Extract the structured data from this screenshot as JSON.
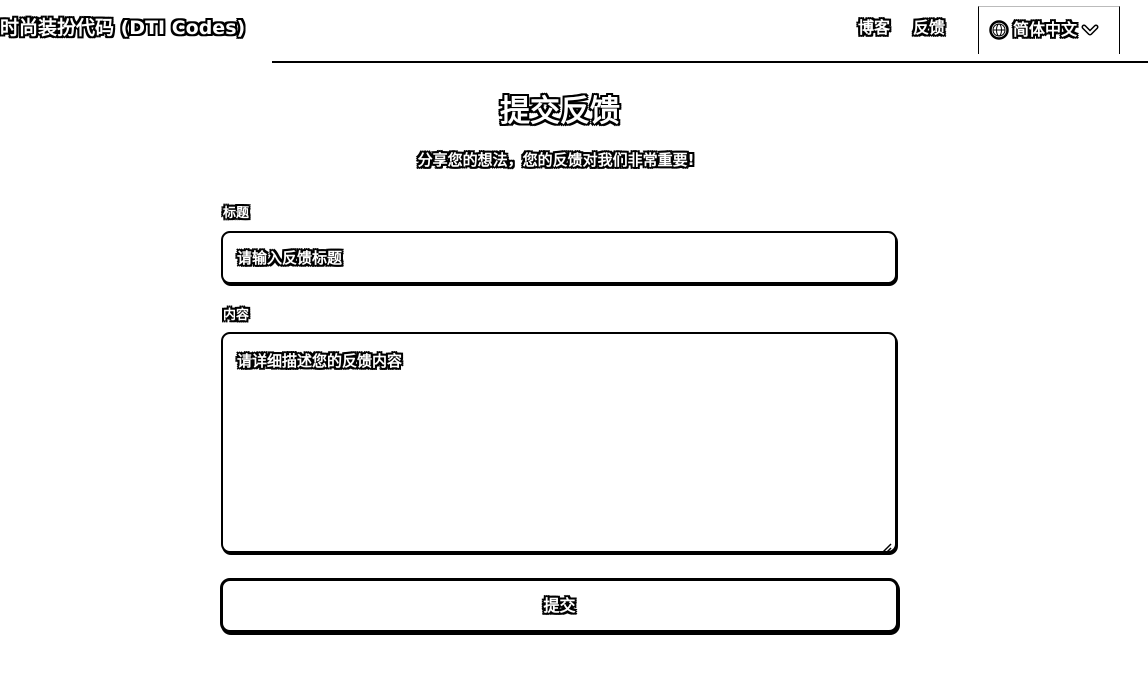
{
  "header": {
    "brand": "时尚装扮代码 (DTI Codes)",
    "nav": {
      "blog": "博客",
      "feedback": "反馈"
    },
    "language": {
      "selected": "简体中文",
      "icon": "globe-icon",
      "chevron": "chevron-down-icon"
    }
  },
  "main": {
    "title": "提交反馈",
    "subtitle": "分享您的想法，您的反馈对我们非常重要!",
    "form": {
      "title_label": "标题",
      "title_placeholder": "请输入反馈标题",
      "content_label": "内容",
      "content_placeholder": "请详细描述您的反馈内容",
      "submit_label": "提交"
    }
  }
}
